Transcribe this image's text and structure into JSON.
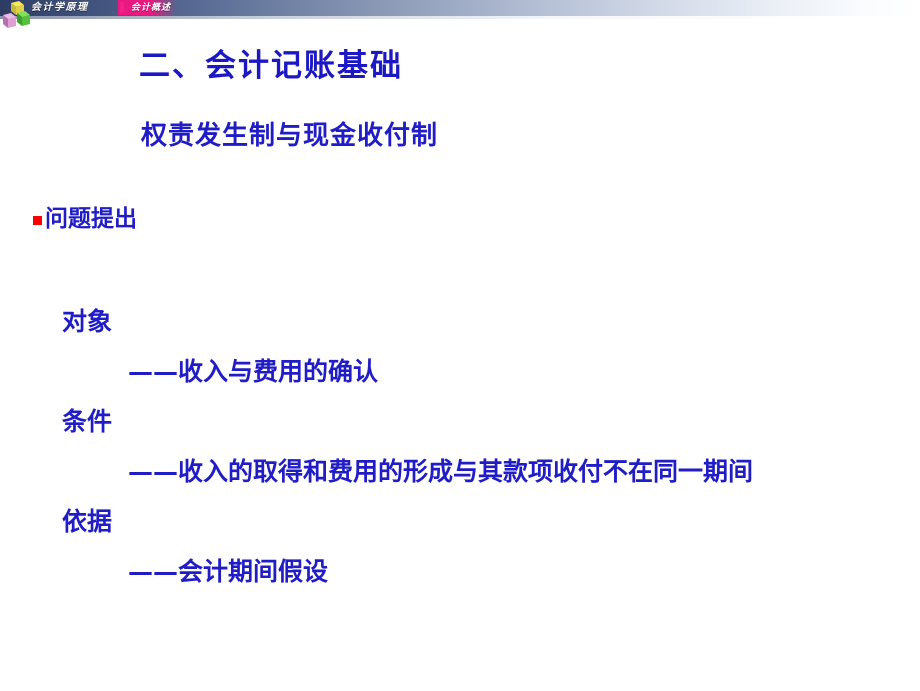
{
  "header": {
    "course_title": "会计学原理",
    "section_title": "会计概述",
    "logo_icon": "colored-cubes-logo-icon",
    "separator_icon": "magenta-separator-icon"
  },
  "slide": {
    "title": "二、会计记账基础",
    "subtitle": "权责发生制与现金收付制",
    "bullet": {
      "marker_icon": "red-square-bullet-icon",
      "label": "问题提出"
    },
    "items": [
      {
        "term": "对象",
        "definition": "——收入与费用的确认"
      },
      {
        "term": "条件",
        "definition": "——收入的取得和费用的形成与其款项收付不在同一期间"
      },
      {
        "term": "依据",
        "definition": "——会计期间假设"
      }
    ]
  },
  "colors": {
    "text_blue": "#201cc6",
    "bullet_red": "#ff0000",
    "header_dark": "#2d3c63",
    "header_accent": "#e8197f",
    "background": "#ffffff"
  }
}
